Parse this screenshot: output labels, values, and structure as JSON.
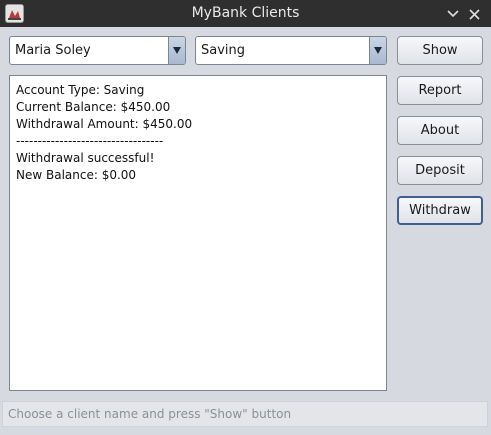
{
  "window": {
    "title": "MyBank Clients",
    "icon": "bank-app-icon"
  },
  "titlebar_buttons": [
    {
      "name": "minimize-icon",
      "glyph": "chevron-down"
    },
    {
      "name": "close-icon",
      "glyph": "x"
    }
  ],
  "client_combo": {
    "selected": "Maria Soley"
  },
  "account_combo": {
    "selected": "Saving"
  },
  "buttons": {
    "show": "Show",
    "report": "Report",
    "about": "About",
    "deposit": "Deposit",
    "withdraw": "Withdraw"
  },
  "output": {
    "lines": [
      "Account Type: Saving",
      "Current Balance: $450.00",
      "Withdrawal Amount: $450.00",
      "----------------------------------",
      "Withdrawal successful!",
      "New Balance: $0.00"
    ]
  },
  "statusbar": {
    "text": "Choose a client name and press \"Show\" button"
  },
  "colors": {
    "titlebar": "#2f2f2f",
    "window_bg": "#d6d9df",
    "focus_border": "#3f5f92",
    "combo_arrow": "#a8b9cf"
  }
}
